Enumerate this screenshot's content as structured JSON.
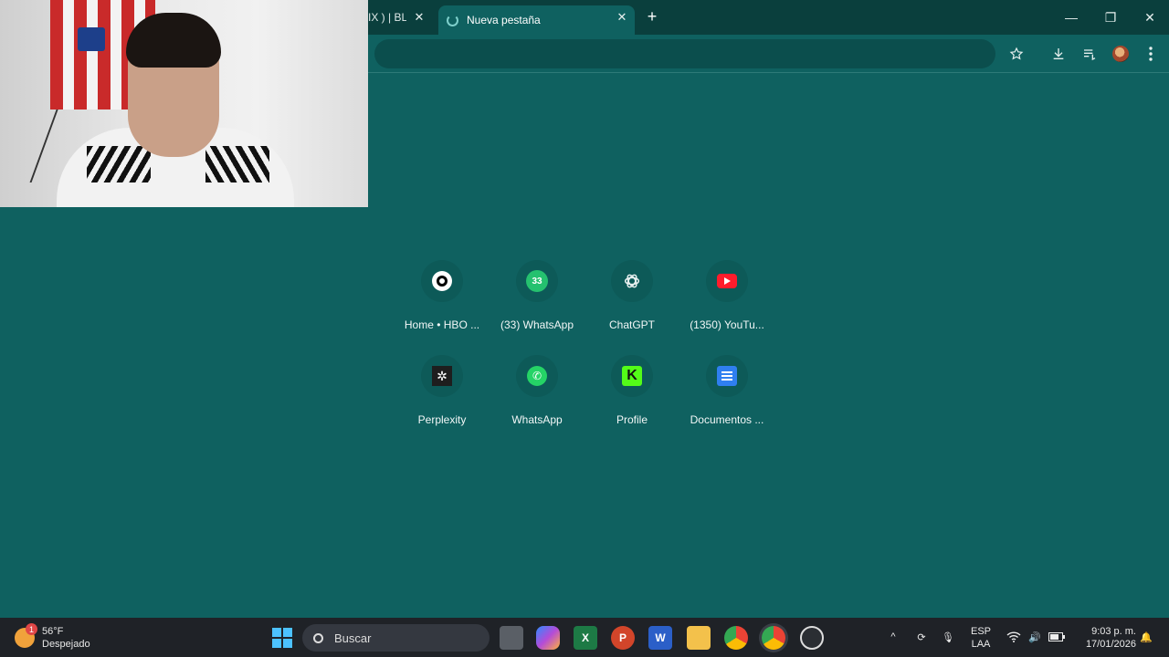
{
  "browser": {
    "tabs": [
      {
        "label": "IX ) | BL",
        "active": false
      },
      {
        "label": "Nueva pestaña",
        "active": true
      }
    ],
    "new_tab_icon": "plus-icon",
    "window_controls": [
      "minimize-icon",
      "restore-icon",
      "close-icon"
    ],
    "toolbar_icons": [
      "star-icon",
      "download-icon",
      "reading-list-icon",
      "avatar",
      "menu-icon"
    ]
  },
  "shortcuts": [
    {
      "label": "Home • HBO ...",
      "icon": "hbo-icon"
    },
    {
      "label": "(33) WhatsApp",
      "icon": "whatsapp-badge-icon",
      "badge": "33"
    },
    {
      "label": "ChatGPT",
      "icon": "chatgpt-icon"
    },
    {
      "label": "(1350) YouTu...",
      "icon": "youtube-icon"
    },
    {
      "label": "Perplexity",
      "icon": "perplexity-icon"
    },
    {
      "label": "WhatsApp",
      "icon": "whatsapp-icon"
    },
    {
      "label": "Profile",
      "icon": "kick-icon",
      "glyph": "K"
    },
    {
      "label": "Documentos ...",
      "icon": "docs-icon"
    }
  ],
  "taskbar": {
    "weather": {
      "temp": "56°F",
      "condition": "Despejado",
      "alert_count": "1"
    },
    "search_placeholder": "Buscar",
    "apps": [
      "start-icon",
      "task-view-icon",
      "copilot-icon",
      "excel-icon",
      "powerpoint-icon",
      "word-icon",
      "file-explorer-icon",
      "chrome-icon",
      "chrome-profile-icon",
      "obs-icon"
    ],
    "tray": {
      "lang": "ESP",
      "layout": "LAA"
    },
    "clock": {
      "time": "9:03 p. m.",
      "date": "17/01/2026"
    }
  },
  "colors": {
    "page_bg": "#0f6160",
    "titlebar_bg": "#0a3f3d",
    "taskbar_bg": "#1f2227"
  }
}
